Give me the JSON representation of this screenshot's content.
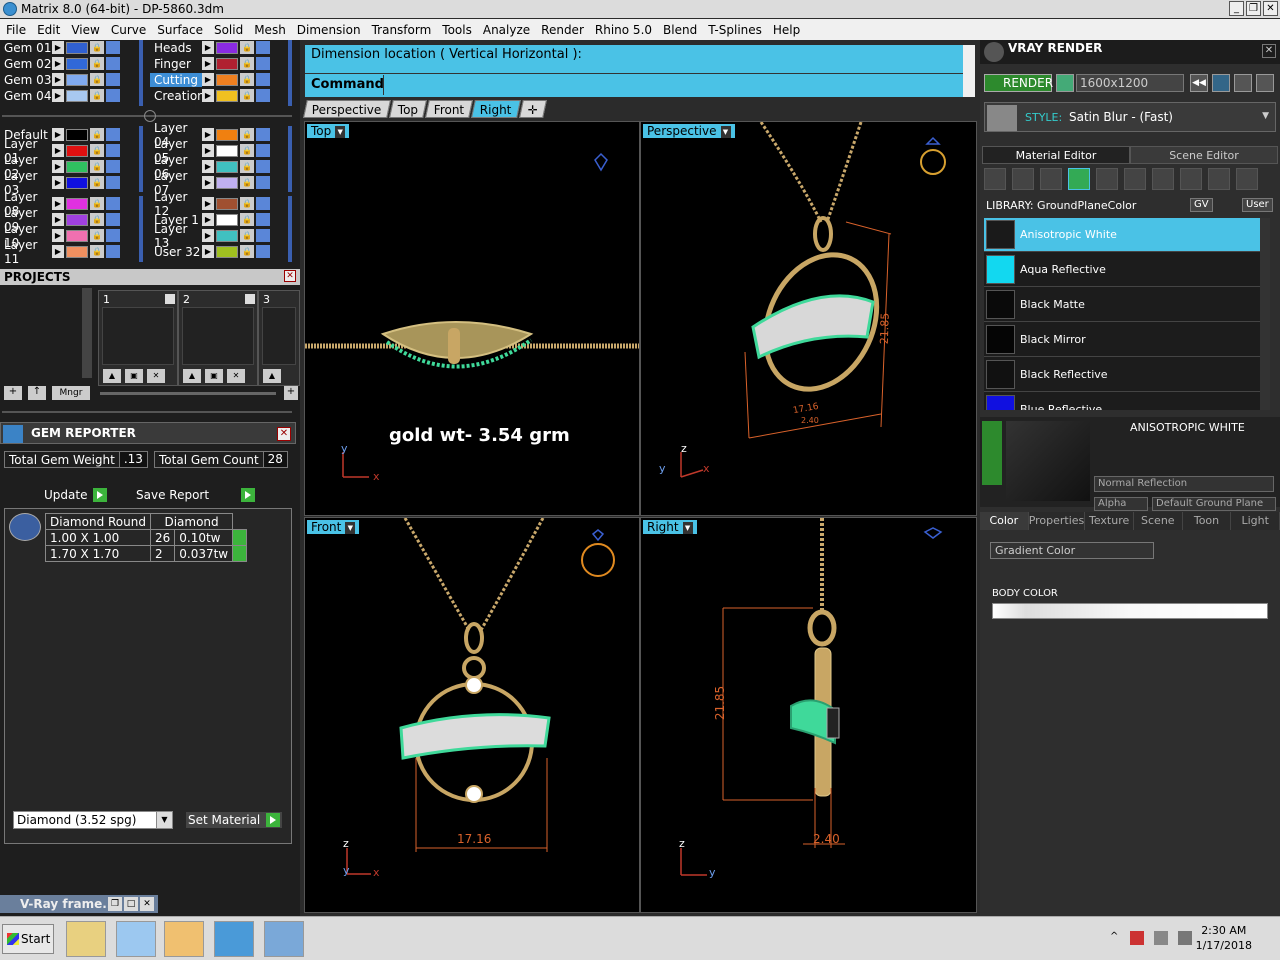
{
  "window": {
    "title": "Matrix 8.0 (64-bit) - DP-5860.3dm"
  },
  "menu": [
    "File",
    "Edit",
    "View",
    "Curve",
    "Surface",
    "Solid",
    "Mesh",
    "Dimension",
    "Transform",
    "Tools",
    "Analyze",
    "Render",
    "Rhino 5.0",
    "Blend",
    "T-Splines",
    "Help"
  ],
  "layers": {
    "gems": [
      {
        "name": "Gem 01",
        "color": "#3060d0"
      },
      {
        "name": "Gem 02",
        "color": "#3068d8"
      },
      {
        "name": "Gem 03",
        "color": "#80aaf0"
      },
      {
        "name": "Gem 04",
        "color": "#a8c8f0"
      }
    ],
    "groups": [
      {
        "name": "Heads",
        "color": "#8a2be2"
      },
      {
        "name": "Finger",
        "color": "#b02030"
      },
      {
        "name": "Cutting",
        "color": "#f08020",
        "selected": true
      },
      {
        "name": "Creation",
        "color": "#f0c020"
      }
    ],
    "layers_left": [
      {
        "name": "Default",
        "color": "#000000"
      },
      {
        "name": "Layer 01",
        "color": "#e01010"
      },
      {
        "name": "Layer 02",
        "color": "#30c060"
      },
      {
        "name": "Layer 03",
        "color": "#1010e0"
      },
      {
        "name": "Layer 08",
        "color": "#e030e0"
      },
      {
        "name": "Layer 09",
        "color": "#a040e0"
      },
      {
        "name": "Layer 10",
        "color": "#f070b0"
      },
      {
        "name": "Layer 11",
        "color": "#f09060"
      }
    ],
    "layers_right": [
      {
        "name": "Layer 04",
        "color": "#f08010"
      },
      {
        "name": "Layer 05",
        "color": "#ffffff"
      },
      {
        "name": "Layer 06",
        "color": "#40c0c0"
      },
      {
        "name": "Layer 07",
        "color": "#c0b0f0"
      },
      {
        "name": "Layer 12",
        "color": "#a05030"
      },
      {
        "name": "Layer 1",
        "color": "#ffffff"
      },
      {
        "name": "Layer 13",
        "color": "#40c0c0"
      },
      {
        "name": "User 32",
        "color": "#a0c020"
      }
    ]
  },
  "projects": {
    "title": "PROJECTS",
    "slots": [
      "1",
      "2",
      "3"
    ],
    "mngr_label": "Mngr"
  },
  "gem_reporter": {
    "title": "GEM REPORTER",
    "total_weight_label": "Total Gem Weight",
    "total_weight": ".13",
    "total_count_label": "Total Gem Count",
    "total_count": "28",
    "update_label": "Update",
    "save_report_label": "Save Report",
    "table_headers": [
      "Diamond Round",
      "Diamond"
    ],
    "rows": [
      {
        "size": "1.00 X 1.00",
        "count": "26",
        "weight": "0.10tw"
      },
      {
        "size": "1.70 X 1.70",
        "count": "2",
        "weight": "0.037tw"
      }
    ],
    "material_select": "Diamond     (3.52 spg)",
    "set_material_label": "Set Material"
  },
  "vray_frame": {
    "label": "V-Ray frame..."
  },
  "command": {
    "prompt": "Dimension location ( Vertical  Horizontal ):",
    "label": "Command:"
  },
  "view_tabs": [
    "Perspective",
    "Top",
    "Front",
    "Right"
  ],
  "active_view_tab": "Right",
  "viewports": {
    "top": {
      "label": "Top",
      "annotation": "gold wt- 3.54 grm",
      "axis_y": "y",
      "axis_x": "x"
    },
    "perspective": {
      "label": "Perspective",
      "dim1": "21.85",
      "dim2": "17.16",
      "dim3": "2.40",
      "axis_z": "z",
      "axis_y": "y",
      "axis_x": "x"
    },
    "front": {
      "label": "Front",
      "dim_width": "17.16",
      "axis_z": "z",
      "axis_y": "y",
      "axis_x": "x"
    },
    "right": {
      "label": "Right",
      "dim_height": "21.85",
      "dim_depth": "2.40",
      "axis_z": "z",
      "axis_y": "y"
    }
  },
  "vray": {
    "title": "VRAY RENDER",
    "render_label": "RENDER",
    "resolution": "1600x1200",
    "style_label": "STYLE:",
    "style_value": "Satin Blur - (Fast)",
    "tabs": [
      "Material Editor",
      "Scene Editor"
    ],
    "library_label": "LIBRARY: GroundPlaneColor",
    "gv_label": "GV",
    "user_label": "User",
    "materials": [
      {
        "name": "Anisotropic White",
        "swatch": "#1a1a1a",
        "selected": true
      },
      {
        "name": "Aqua Reflective",
        "swatch": "#12d8f0"
      },
      {
        "name": "Black Matte",
        "swatch": "#0a0a0a"
      },
      {
        "name": "Black Mirror",
        "swatch": "#050505"
      },
      {
        "name": "Black Reflective",
        "swatch": "#111111"
      },
      {
        "name": "Blue Reflective",
        "swatch": "#1010e0"
      }
    ],
    "preview_title": "ANISOTROPIC WHITE",
    "reflection_mode": "Normal Reflection",
    "alpha_label": "Alpha",
    "ground_plane_label": "Default Ground Plane",
    "bottom_tabs": [
      "Color",
      "Properties",
      "Texture",
      "Scene",
      "Toon",
      "Light"
    ],
    "gradient_select": "Gradient Color",
    "body_color_label": "BODY COLOR"
  },
  "taskbar": {
    "start_label": "Start",
    "time": "2:30 AM",
    "date": "1/17/2018"
  }
}
